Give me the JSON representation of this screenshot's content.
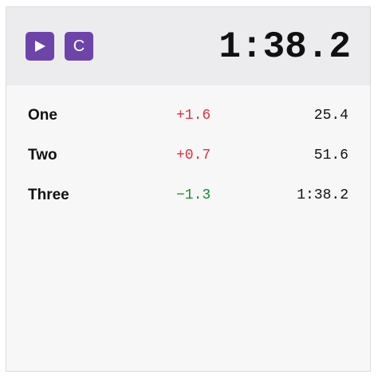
{
  "timer": {
    "display": "1:38.2"
  },
  "controls": {
    "play_icon": "play-icon",
    "clear_label": "C",
    "button_color": "#6d45a9"
  },
  "laps": [
    {
      "name": "One",
      "delta": "+1.6",
      "delta_sign": "positive",
      "time": "25.4"
    },
    {
      "name": "Two",
      "delta": "+0.7",
      "delta_sign": "positive",
      "time": "51.6"
    },
    {
      "name": "Three",
      "delta": "−1.3",
      "delta_sign": "negative",
      "time": "1:38.2"
    }
  ],
  "colors": {
    "positive_delta": "#e0303c",
    "negative_delta": "#1e8a2e"
  }
}
